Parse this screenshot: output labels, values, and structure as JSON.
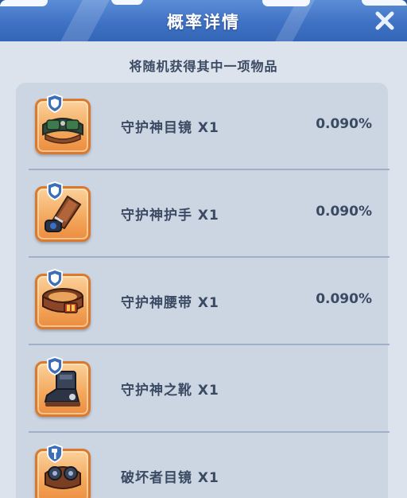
{
  "dialog": {
    "title": "概率详情",
    "subtitle": "将随机获得其中一项物品",
    "close_icon": "close-x-icon"
  },
  "items": [
    {
      "name": "守护神目镜 X1",
      "probability": "0.090%",
      "badge_icon": "shield-badge-icon",
      "item_icon": "goggles-icon"
    },
    {
      "name": "守护神护手 X1",
      "probability": "0.090%",
      "badge_icon": "shield-badge-icon",
      "item_icon": "gauntlet-icon"
    },
    {
      "name": "守护神腰带 X1",
      "probability": "0.090%",
      "badge_icon": "shield-badge-icon",
      "item_icon": "belt-icon"
    },
    {
      "name": "守护神之靴 X1",
      "probability": "",
      "badge_icon": "shield-badge-icon",
      "item_icon": "boots-icon"
    },
    {
      "name": "破坏者目镜 X1",
      "probability": "",
      "badge_icon": "hammer-badge-icon",
      "item_icon": "goggles-icon"
    }
  ],
  "colors": {
    "header": "#3f72c4",
    "panel": "#dde3ec",
    "list": "#ccd5e2",
    "text": "#3b4a63",
    "item_frame": "#f3a65b"
  }
}
